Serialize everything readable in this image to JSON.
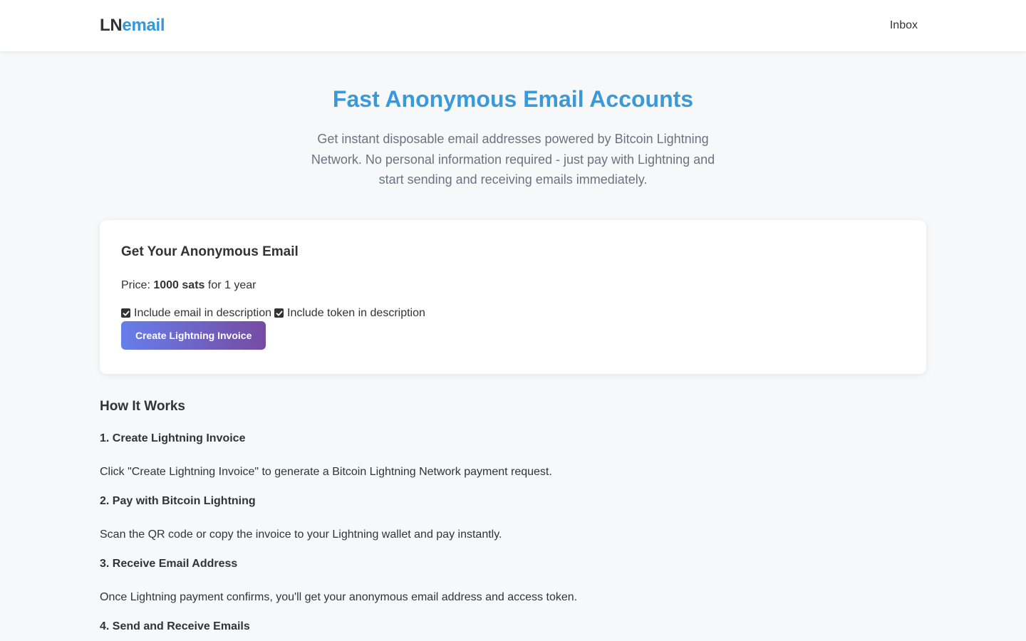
{
  "header": {
    "logo_prefix": "LN",
    "logo_suffix": "email",
    "nav_inbox": "Inbox"
  },
  "hero": {
    "title": "Fast Anonymous Email Accounts",
    "subtitle": "Get instant disposable email addresses powered by Bitcoin Lightning Network. No personal information required - just pay with Lightning and start sending and receiving emails immediately."
  },
  "card": {
    "title": "Get Your Anonymous Email",
    "price_label": "Price:",
    "price_amount": "1000 sats",
    "price_period": "for 1 year",
    "options": [
      {
        "label": "Include email in description",
        "checked": true
      },
      {
        "label": "Include token in description",
        "checked": true
      }
    ],
    "button_label": "Create Lightning Invoice"
  },
  "how_it_works": {
    "title": "How It Works",
    "steps": [
      {
        "title": "1. Create Lightning Invoice",
        "desc": "Click \"Create Lightning Invoice\" to generate a Bitcoin Lightning Network payment request."
      },
      {
        "title": "2. Pay with Bitcoin Lightning",
        "desc": "Scan the QR code or copy the invoice to your Lightning wallet and pay instantly."
      },
      {
        "title": "3. Receive Email Address",
        "desc": "Once Lightning payment confirms, you'll get your anonymous email address and access token."
      },
      {
        "title": "4. Send and Receive Emails",
        "desc": ""
      }
    ]
  },
  "colors": {
    "brand_blue": "#3498db",
    "button_gradient_start": "#667eea",
    "button_gradient_end": "#764ba2"
  }
}
